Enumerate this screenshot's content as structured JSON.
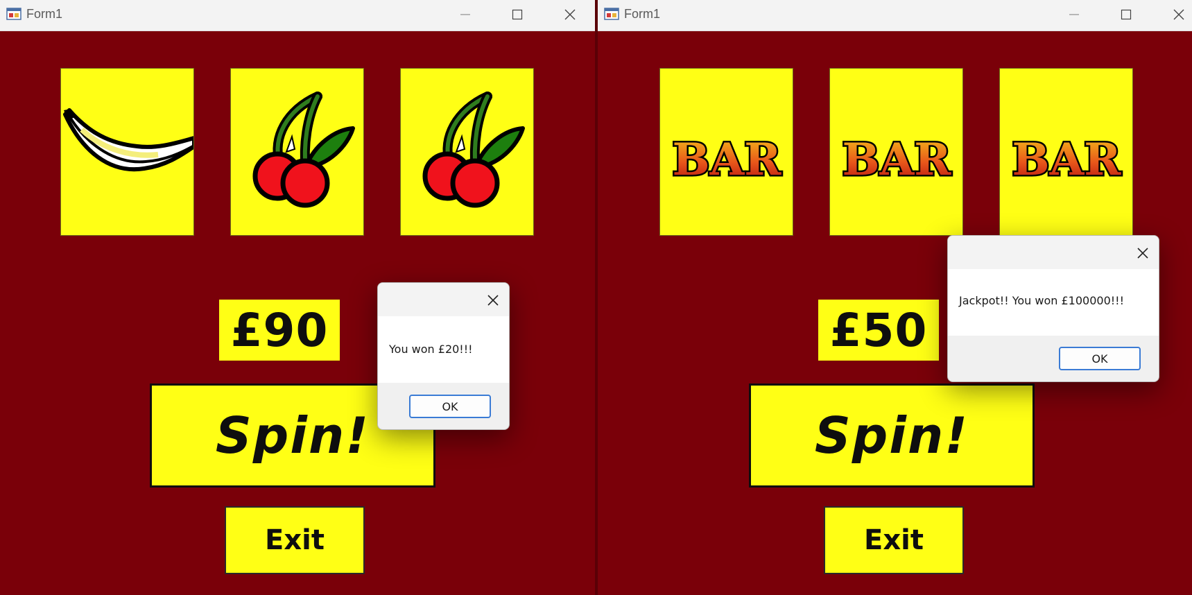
{
  "left_window": {
    "title": "Form1",
    "reels": [
      "banana-icon",
      "cherries-icon",
      "cherries-icon"
    ],
    "balance": "£90",
    "spin_label": "Spin!",
    "exit_label": "Exit",
    "dialog": {
      "message": "You won £20!!!",
      "ok_label": "OK"
    }
  },
  "right_window": {
    "title": "Form1",
    "reels": [
      "bar-icon",
      "bar-icon",
      "bar-icon"
    ],
    "reel_text": "BAR",
    "balance": "£50",
    "spin_label": "Spin!",
    "exit_label": "Exit",
    "dialog": {
      "message": "Jackpot!! You won £100000!!!",
      "ok_label": "OK"
    }
  },
  "colors": {
    "background": "#7a0009",
    "reel_yellow": "#ffff15",
    "titlebar": "#f3f3f3",
    "ok_border": "#3a7bd5"
  }
}
